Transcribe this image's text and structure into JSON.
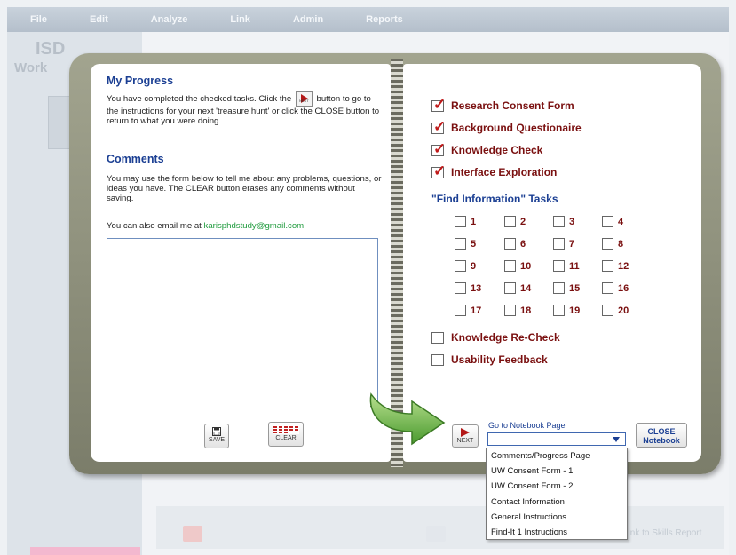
{
  "menu": [
    "File",
    "Edit",
    "Analyze",
    "Link",
    "Admin",
    "Reports"
  ],
  "app": {
    "logo_line1": "ISD",
    "logo_line2": "Work",
    "footer_text": "Link to Skills Report"
  },
  "left_page": {
    "progress_title": "My Progress",
    "progress_text_a": "You have completed the checked tasks. Click the",
    "progress_text_b": "button to go to the instructions for your next 'treasure hunt' or click the CLOSE button to return to what you were doing.",
    "next_icon_label": "NEXT",
    "comments_title": "Comments",
    "comments_text": "You may use the form below to tell me about any problems, questions, or ideas you have. The CLEAR button erases any comments without saving.",
    "email_prefix": "You can also email me at",
    "email": "karisphdstudy@gmail.com",
    "email_suffix": ".",
    "comment_value": "",
    "save_label": "SAVE",
    "clear_label": "CLEAR"
  },
  "right_page": {
    "tasks": [
      {
        "label": "Research Consent Form",
        "checked": true
      },
      {
        "label": "Background Questionaire",
        "checked": true
      },
      {
        "label": "Knowledge Check",
        "checked": true
      },
      {
        "label": "Interface Exploration",
        "checked": true
      }
    ],
    "find_title": "\"Find Information\" Tasks",
    "find_items": [
      "1",
      "2",
      "3",
      "4",
      "5",
      "6",
      "7",
      "8",
      "9",
      "10",
      "11",
      "12",
      "13",
      "14",
      "15",
      "16",
      "17",
      "18",
      "19",
      "20"
    ],
    "extra_tasks": [
      {
        "label": "Knowledge Re-Check",
        "checked": false
      },
      {
        "label": "Usability Feedback",
        "checked": false
      }
    ],
    "next_label": "NEXT",
    "goto_label": "Go to Notebook Page",
    "select_value": "",
    "close_label_1": "CLOSE",
    "close_label_2": "Notebook",
    "dropdown_options": [
      "Comments/Progress Page",
      "UW Consent Form - 1",
      "UW Consent Form - 2",
      "Contact Information",
      "General Instructions",
      "Find-It 1 Instructions"
    ]
  },
  "colors": {
    "heading": "#1b3f93",
    "task_text": "#7a1010",
    "check": "#c01a1a",
    "email": "#1e9a3c",
    "arrow": "#5fa83a"
  }
}
